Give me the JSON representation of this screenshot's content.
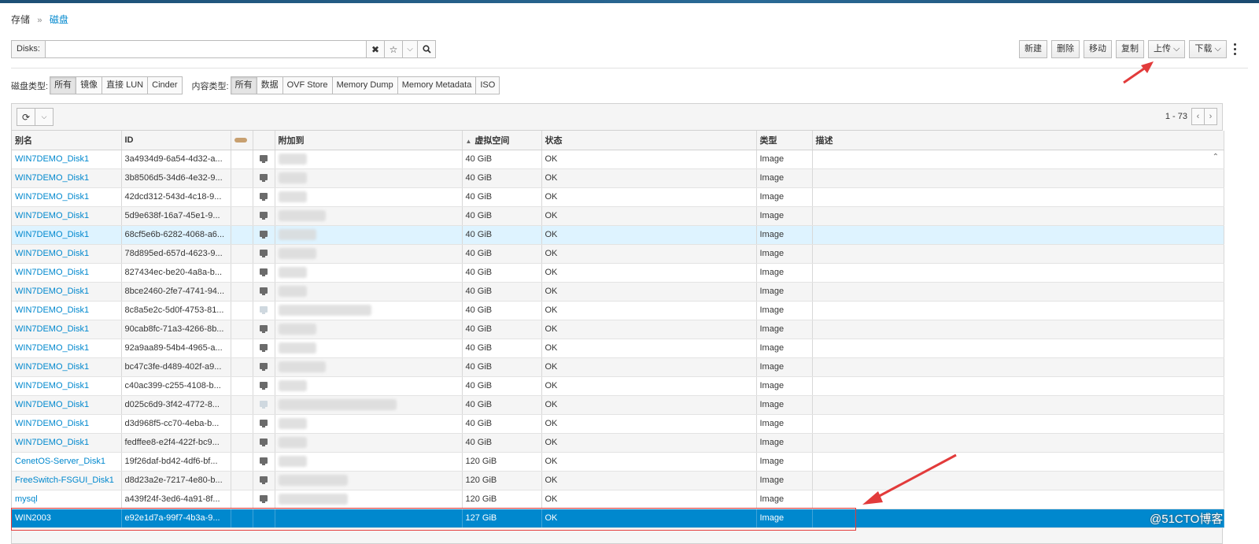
{
  "breadcrumb": {
    "parent": "存储",
    "separator": "»",
    "current": "磁盘"
  },
  "search": {
    "label": "Disks:",
    "value": ""
  },
  "actions": [
    "新建",
    "删除",
    "移动",
    "复制",
    "上传",
    "下载"
  ],
  "filters": {
    "disk_type_label": "磁盘类型:",
    "disk_types": [
      "所有",
      "镜像",
      "直接 LUN",
      "Cinder"
    ],
    "content_type_label": "内容类型:",
    "content_types": [
      "所有",
      "数据",
      "OVF Store",
      "Memory Dump",
      "Memory Metadata",
      "ISO"
    ]
  },
  "pager": {
    "range": "1 - 73"
  },
  "columns": {
    "alias": "别名",
    "id": "ID",
    "attached": "附加到",
    "virtual_size": "虚拟空间",
    "status": "状态",
    "type": "类型",
    "description": "描述"
  },
  "rows": [
    {
      "alias": "WIN7DEMO_Disk1",
      "id": "3a4934d9-6a54-4d32-a...",
      "size": "40 GiB",
      "status": "OK",
      "type": "Image"
    },
    {
      "alias": "WIN7DEMO_Disk1",
      "id": "3b8506d5-34d6-4e32-9...",
      "size": "40 GiB",
      "status": "OK",
      "type": "Image"
    },
    {
      "alias": "WIN7DEMO_Disk1",
      "id": "42dcd312-543d-4c18-9...",
      "size": "40 GiB",
      "status": "OK",
      "type": "Image"
    },
    {
      "alias": "WIN7DEMO_Disk1",
      "id": "5d9e638f-16a7-45e1-9...",
      "size": "40 GiB",
      "status": "OK",
      "type": "Image"
    },
    {
      "alias": "WIN7DEMO_Disk1",
      "id": "68cf5e6b-6282-4068-a6...",
      "size": "40 GiB",
      "status": "OK",
      "type": "Image"
    },
    {
      "alias": "WIN7DEMO_Disk1",
      "id": "78d895ed-657d-4623-9...",
      "size": "40 GiB",
      "status": "OK",
      "type": "Image"
    },
    {
      "alias": "WIN7DEMO_Disk1",
      "id": "827434ec-be20-4a8a-b...",
      "size": "40 GiB",
      "status": "OK",
      "type": "Image"
    },
    {
      "alias": "WIN7DEMO_Disk1",
      "id": "8bce2460-2fe7-4741-94...",
      "size": "40 GiB",
      "status": "OK",
      "type": "Image"
    },
    {
      "alias": "WIN7DEMO_Disk1",
      "id": "8c8a5e2c-5d0f-4753-81...",
      "size": "40 GiB",
      "status": "OK",
      "type": "Image"
    },
    {
      "alias": "WIN7DEMO_Disk1",
      "id": "90cab8fc-71a3-4266-8b...",
      "size": "40 GiB",
      "status": "OK",
      "type": "Image"
    },
    {
      "alias": "WIN7DEMO_Disk1",
      "id": "92a9aa89-54b4-4965-a...",
      "size": "40 GiB",
      "status": "OK",
      "type": "Image"
    },
    {
      "alias": "WIN7DEMO_Disk1",
      "id": "bc47c3fe-d489-402f-a9...",
      "size": "40 GiB",
      "status": "OK",
      "type": "Image"
    },
    {
      "alias": "WIN7DEMO_Disk1",
      "id": "c40ac399-c255-4108-b...",
      "size": "40 GiB",
      "status": "OK",
      "type": "Image"
    },
    {
      "alias": "WIN7DEMO_Disk1",
      "id": "d025c6d9-3f42-4772-8...",
      "size": "40 GiB",
      "status": "OK",
      "type": "Image"
    },
    {
      "alias": "WIN7DEMO_Disk1",
      "id": "d3d968f5-cc70-4eba-b...",
      "size": "40 GiB",
      "status": "OK",
      "type": "Image"
    },
    {
      "alias": "WIN7DEMO_Disk1",
      "id": "fedffee8-e2f4-422f-bc9...",
      "size": "40 GiB",
      "status": "OK",
      "type": "Image"
    },
    {
      "alias": "CenetOS-Server_Disk1",
      "id": "19f26daf-bd42-4df6-bf...",
      "size": "120 GiB",
      "status": "OK",
      "type": "Image"
    },
    {
      "alias": "FreeSwitch-FSGUI_Disk1",
      "id": "d8d23a2e-7217-4e80-b...",
      "size": "120 GiB",
      "status": "OK",
      "type": "Image"
    },
    {
      "alias": "mysql",
      "id": "a439f24f-3ed6-4a91-8f...",
      "size": "120 GiB",
      "status": "OK",
      "type": "Image"
    },
    {
      "alias": "WIN2003",
      "id": "e92e1d7a-99f7-4b3a-9...",
      "size": "127 GiB",
      "status": "OK",
      "type": "Image"
    }
  ],
  "watermark": "@51CTO博客",
  "colors": {
    "accent": "#0088ce",
    "selected_row": "#0088ce",
    "annotation": "#e23b3b"
  }
}
